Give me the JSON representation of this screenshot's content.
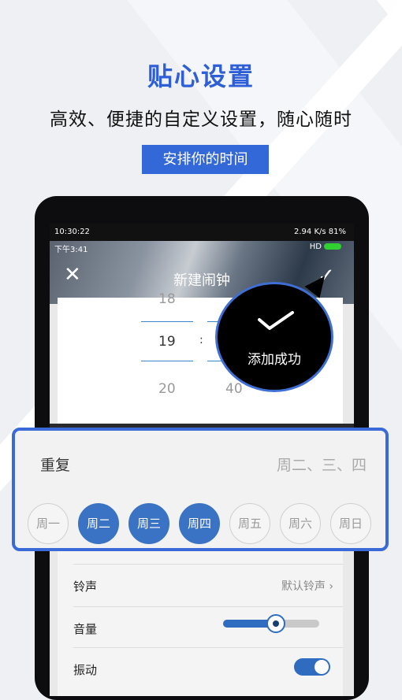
{
  "promo": {
    "title": "贴心设置",
    "subtitle": "高效、便捷的自定义设置，随心随时",
    "tag": "安排你的时间"
  },
  "phone": {
    "outer_status": {
      "time": "10:30:22",
      "right": "2.94 K/s  81%"
    },
    "inner_status": {
      "time": "下午3:41",
      "right": "HD"
    },
    "nav": {
      "title": "新建闹钟",
      "close": "✕",
      "confirm": "✓"
    },
    "picker": {
      "top_hour": "18",
      "hour": "19",
      "separator": ":",
      "bottom_hour": "20",
      "bottom_minute": "40"
    },
    "settings": [
      {
        "label": "铃声",
        "value": "默认铃声 ›"
      },
      {
        "label": "音量",
        "value": ""
      },
      {
        "label": "振动",
        "value": ""
      }
    ],
    "volume_level": 0.55
  },
  "toast": {
    "text": "添加成功"
  },
  "repeat": {
    "label": "重复",
    "value": "周二、三、四",
    "days": [
      {
        "label": "周一",
        "selected": false
      },
      {
        "label": "周二",
        "selected": true
      },
      {
        "label": "周三",
        "selected": true
      },
      {
        "label": "周四",
        "selected": true
      },
      {
        "label": "周五",
        "selected": false
      },
      {
        "label": "周六",
        "selected": false
      },
      {
        "label": "周日",
        "selected": false
      }
    ]
  },
  "colors": {
    "accent": "#3368d8",
    "selected_day": "#3a73c4"
  }
}
